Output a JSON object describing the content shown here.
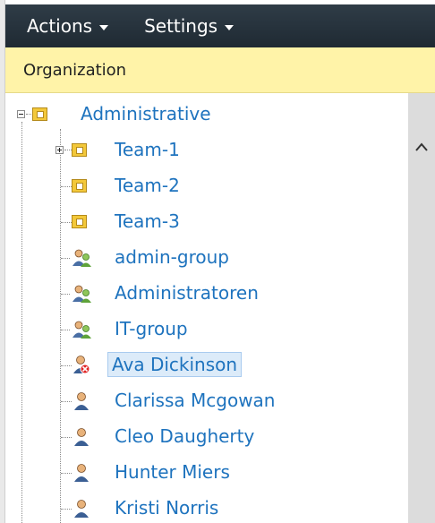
{
  "menubar": {
    "actions_label": "Actions",
    "settings_label": "Settings"
  },
  "header": {
    "title": "Organization"
  },
  "tree": {
    "root": {
      "label": "Administrative",
      "expanded": true
    },
    "nodes": [
      {
        "label": "Team-1",
        "type": "folder",
        "expander": "plus"
      },
      {
        "label": "Team-2",
        "type": "folder"
      },
      {
        "label": "Team-3",
        "type": "folder"
      },
      {
        "label": "admin-group",
        "type": "group"
      },
      {
        "label": "Administratoren",
        "type": "group"
      },
      {
        "label": "IT-group",
        "type": "group"
      },
      {
        "label": "Ava Dickinson",
        "type": "user-disabled",
        "selected": true
      },
      {
        "label": "Clarissa Mcgowan",
        "type": "user"
      },
      {
        "label": "Cleo Daugherty",
        "type": "user"
      },
      {
        "label": "Hunter Miers",
        "type": "user"
      },
      {
        "label": "Kristi Norris",
        "type": "user"
      }
    ]
  },
  "colors": {
    "menubar_bg": "#25313b",
    "header_bg": "#fff3a8",
    "link": "#1e73be",
    "selection_bg": "#dcebf9",
    "scrollbar_bg": "#dcdcdc"
  },
  "icons": {
    "expander_minus": "minus-box-icon",
    "expander_plus": "plus-box-icon",
    "folder": "org-unit-folder-icon",
    "group": "group-icon",
    "user": "user-icon",
    "user_disabled": "disabled-user-icon",
    "scroll_up": "chevron-up-icon"
  }
}
